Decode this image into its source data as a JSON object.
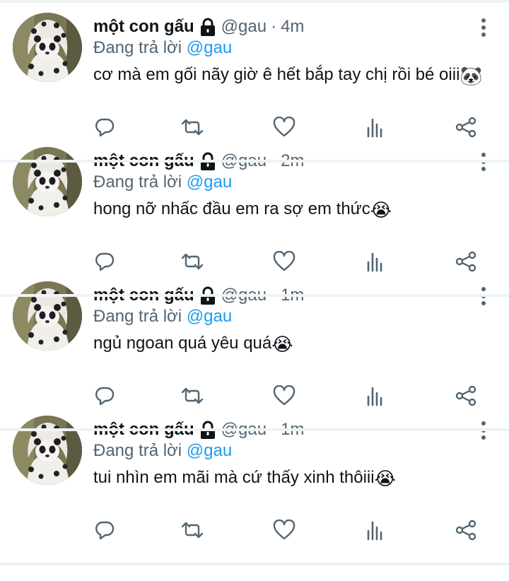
{
  "colors": {
    "text": "#0f1419",
    "muted": "#536471",
    "link": "#1d9bf0",
    "separator": "#eff3f4"
  },
  "tweets": [
    {
      "name": "một con gấu",
      "handle": "@gau",
      "dot": "·",
      "time": "4m",
      "reply_prefix": "Đang trả lời ",
      "reply_to": "@gau",
      "text": "cơ mà em gối nãy giờ ê hết bắp tay chị rồi bé oiii",
      "emoji": "🐼"
    },
    {
      "name": "một con gấu",
      "handle": "@gau",
      "dot": "·",
      "time": "2m",
      "reply_prefix": "Đang trả lời ",
      "reply_to": "@gau",
      "text": "hong nỡ nhấc đầu em ra sợ em thức",
      "emoji": "😭"
    },
    {
      "name": "một con gấu",
      "handle": "@gau",
      "dot": "·",
      "time": "1m",
      "reply_prefix": "Đang trả lời ",
      "reply_to": "@gau",
      "text": "ngủ ngoan quá yêu quá",
      "emoji": "😭"
    },
    {
      "name": "một con gấu",
      "handle": "@gau",
      "dot": "·",
      "time": "1m",
      "reply_prefix": "Đang trả lời ",
      "reply_to": "@gau",
      "text": "tui nhìn em mãi mà cứ thấy xinh thôiii",
      "emoji": "😭"
    }
  ],
  "icons": {
    "header": [
      "lock-icon",
      "more-vertical-icon"
    ],
    "actions": [
      "reply-icon",
      "retweet-icon",
      "like-icon",
      "analytics-icon",
      "share-icon"
    ]
  }
}
